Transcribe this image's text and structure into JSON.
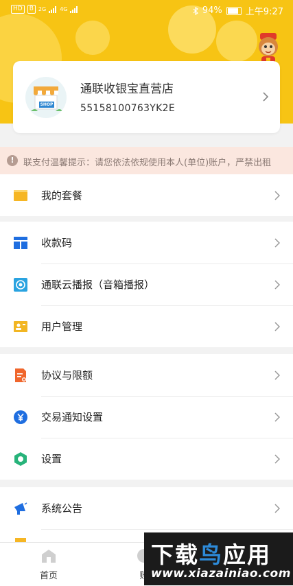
{
  "status_bar": {
    "hd_label": "HD",
    "sim_label": "B",
    "net1": "2G",
    "net2": "4G",
    "battery_percent": "94%",
    "time": "上午9:27"
  },
  "store": {
    "name": "通联收银宝直营店",
    "id": "55158100763YK2E",
    "sign_text": "SHOP"
  },
  "notice": {
    "icon_text": "!",
    "text": "联支付温馨提示：请您依法依规使用本人(单位)账户，严禁出租"
  },
  "menu_groups": [
    {
      "items": [
        {
          "label": "我的套餐",
          "icon": "package-icon",
          "color": "#f6b624"
        }
      ]
    },
    {
      "items": [
        {
          "label": "收款码",
          "icon": "qrcode-layout-icon",
          "color": "#1f6ee0"
        },
        {
          "label": "通联云播报（音箱播报）",
          "icon": "speaker-icon",
          "color": "#2aa3e0"
        },
        {
          "label": "用户管理",
          "icon": "user-card-icon",
          "color": "#f2b623"
        }
      ]
    },
    {
      "items": [
        {
          "label": "协议与限额",
          "icon": "document-icon",
          "color": "#f0662c"
        },
        {
          "label": "交易通知设置",
          "icon": "yuan-bell-icon",
          "color": "#1f6ee0"
        },
        {
          "label": "设置",
          "icon": "gear-icon",
          "color": "#27b37a"
        }
      ]
    },
    {
      "items": [
        {
          "label": "系统公告",
          "icon": "megaphone-icon",
          "color": "#1f6ee0"
        }
      ]
    }
  ],
  "bottom_nav": [
    {
      "label": "首页",
      "icon": "home-icon"
    },
    {
      "label": "账",
      "icon": "bill-icon"
    }
  ],
  "watermark": {
    "title_white": "下载",
    "title_blue": "鸟",
    "title_white2": "应用",
    "url": "www.xiazainiao.com"
  },
  "colors": {
    "brand_yellow": "#f7c414",
    "notice_bg": "#fbe7df"
  }
}
